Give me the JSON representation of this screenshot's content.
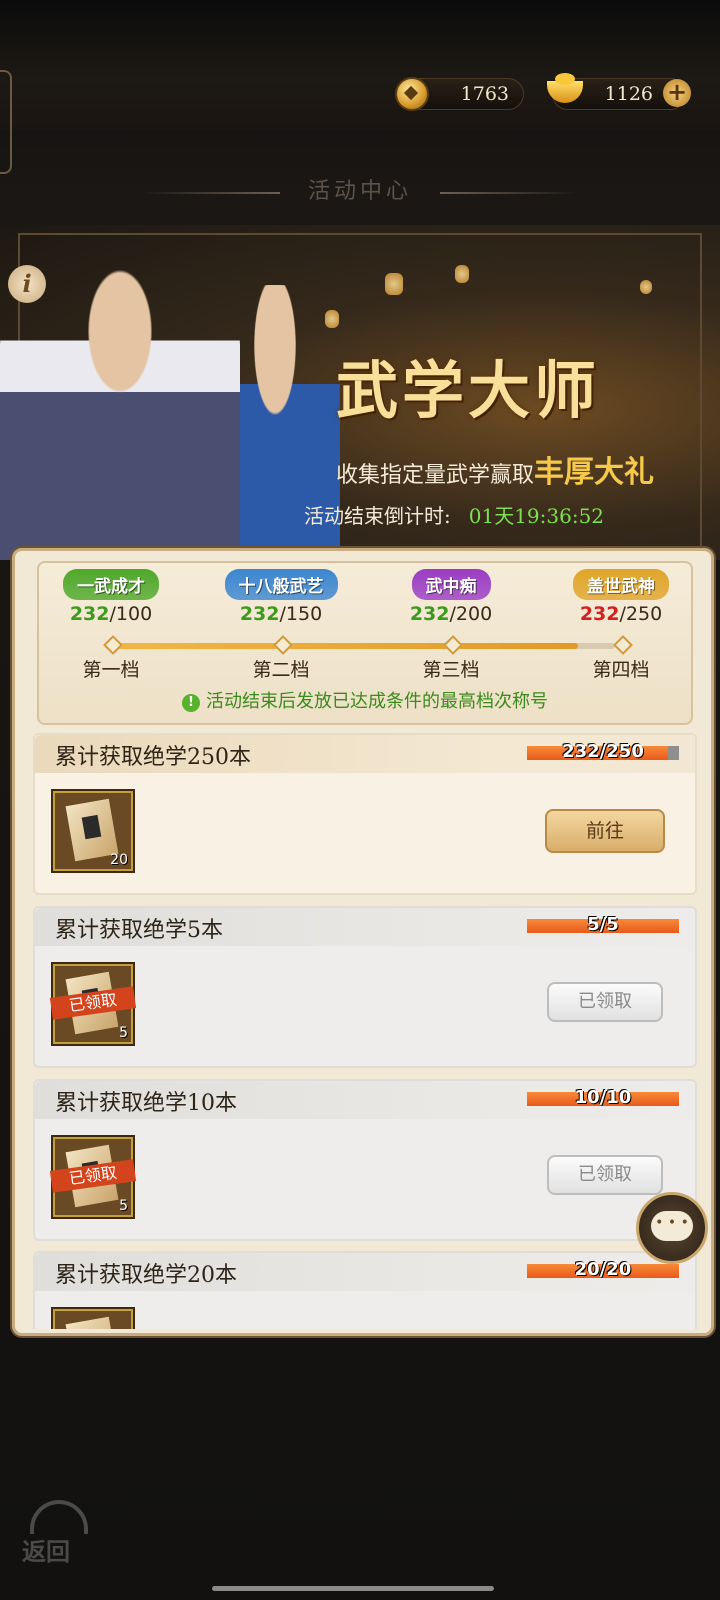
{
  "currency": {
    "coins": "1763",
    "ingots": "1126"
  },
  "header": {
    "title": "活动中心"
  },
  "banner": {
    "title": "武学大师",
    "subtitle": "收集指定量武学赢取",
    "subtitle_highlight": "丰厚大礼",
    "countdown_label": "活动结束倒计时:",
    "countdown_value": "01天19:36:52"
  },
  "tiers": [
    {
      "badge": "一武成才",
      "current": "232",
      "target": "/100",
      "label": "第一档",
      "color": "#4fa82a",
      "reached": true
    },
    {
      "badge": "十八般武艺",
      "current": "232",
      "target": "/150",
      "label": "第二档",
      "color": "#3b86d0",
      "reached": true
    },
    {
      "badge": "武中痴",
      "current": "232",
      "target": "/200",
      "label": "第三档",
      "color": "#9b3cc4",
      "reached": true
    },
    {
      "badge": "盖世武神",
      "current": "232",
      "target": "/250",
      "label": "第四档",
      "color": "#e0a52a",
      "reached": false
    }
  ],
  "tier_progress": 0.928,
  "tier_note": "活动结束后发放已达成条件的最高档次称号",
  "tasks": [
    {
      "name": "累计获取绝学250本",
      "progress": "232/250",
      "fraction": 0.928,
      "item_count": "20",
      "button": "前往",
      "claimed": false
    },
    {
      "name": "累计获取绝学5本",
      "progress": "5/5",
      "fraction": 1,
      "item_count": "5",
      "button": "已领取",
      "claimed": true,
      "stamp": "已领取"
    },
    {
      "name": "累计获取绝学10本",
      "progress": "10/10",
      "fraction": 1,
      "item_count": "5",
      "button": "已领取",
      "claimed": true,
      "stamp": "已领取"
    },
    {
      "name": "累计获取绝学20本",
      "progress": "20/20",
      "fraction": 1,
      "item_count": "",
      "button": "",
      "claimed": true
    }
  ],
  "back_label": "返回",
  "icons": {
    "coin": "coin-icon",
    "ingot": "gold-ingot-icon",
    "add": "plus-icon",
    "info": "info-icon",
    "chat": "chat-bubble-icon",
    "back": "back-arrow-icon"
  }
}
